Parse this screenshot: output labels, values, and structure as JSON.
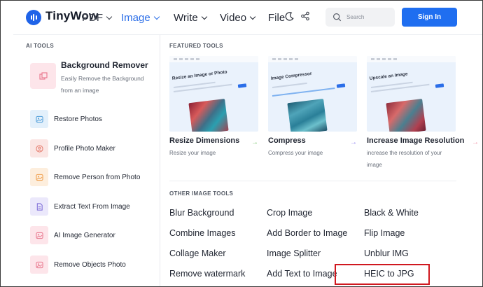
{
  "brand": {
    "name": "TinyWow"
  },
  "nav": {
    "pdf": "PDF",
    "image": "Image",
    "write": "Write",
    "video": "Video",
    "file": "File"
  },
  "header": {
    "search_placeholder": "Search",
    "signin_label": "Sign In",
    "icons": [
      "moon-icon",
      "share-icon",
      "search-icon"
    ]
  },
  "colors": {
    "accent": "#1f6ef0",
    "active_nav": "#2b6ee8",
    "highlight": "#d0181f"
  },
  "ai_tools": {
    "label": "AI TOOLS",
    "featured": {
      "title": "Background Remover",
      "desc": "Easily Remove the Background from an image"
    },
    "items": [
      {
        "label": "Restore Photos"
      },
      {
        "label": "Profile Photo Maker"
      },
      {
        "label": "Remove Person from Photo"
      },
      {
        "label": "Extract Text From Image"
      },
      {
        "label": "AI Image Generator"
      },
      {
        "label": "Remove Objects Photo"
      }
    ]
  },
  "featured_tools": {
    "label": "FEATURED TOOLS",
    "cards": [
      {
        "thumb_title": "Resize an Image or Photo",
        "title": "Resize Dimensions",
        "desc": "Resize your image",
        "arrow": "→"
      },
      {
        "thumb_title": "Image Compressor",
        "title": "Compress",
        "desc": "Compress your image",
        "arrow": "→"
      },
      {
        "thumb_title": "Upscale an Image",
        "title": "Increase Image Resolution",
        "desc": "increase the resolution of your image",
        "arrow": "→"
      }
    ]
  },
  "other_tools": {
    "label": "OTHER IMAGE TOOLS",
    "col1": [
      "Blur Background",
      "Combine Images",
      "Collage Maker",
      "Remove watermark"
    ],
    "col2": [
      "Crop Image",
      "Add Border to Image",
      "Image Splitter",
      "Add Text to Image"
    ],
    "col3": [
      "Black & White",
      "Flip Image",
      "Unblur IMG",
      "HEIC to JPG"
    ]
  }
}
